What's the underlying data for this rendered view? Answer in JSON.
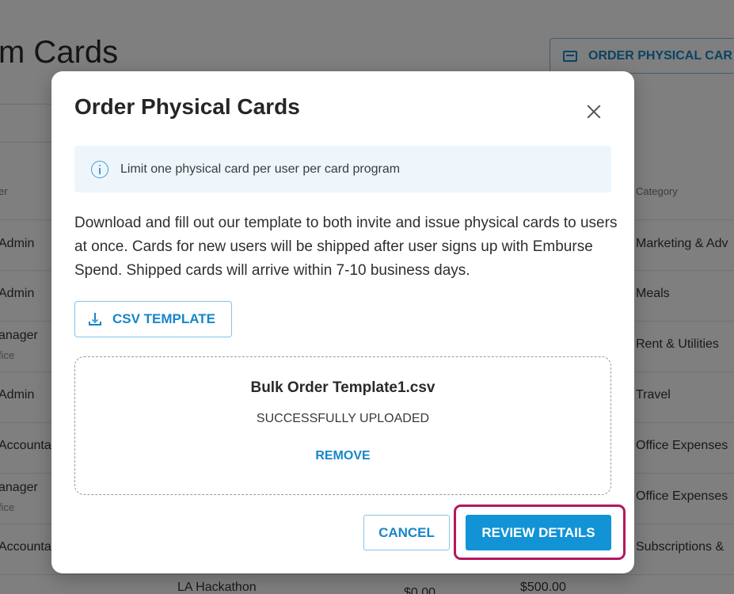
{
  "background": {
    "page_title": "m Cards",
    "order_button_label": "ORDER PHYSICAL CAR",
    "column_left_header": "er",
    "column_category_header": "Category",
    "rows": [
      {
        "left": "Admin",
        "left_sub": "",
        "category": "Marketing & Adv"
      },
      {
        "left": "Admin",
        "left_sub": "",
        "category": "Meals"
      },
      {
        "left": "anager",
        "left_sub": "fice",
        "category": "Rent & Utilities"
      },
      {
        "left": "Admin",
        "left_sub": "",
        "category": "Travel"
      },
      {
        "left": "Accounta",
        "left_sub": "",
        "category": "Office Expenses"
      },
      {
        "left": "anager",
        "left_sub": "fice",
        "category": "Office Expenses"
      },
      {
        "left": "Accounta",
        "left_sub": "",
        "category": "Subscriptions &"
      }
    ],
    "bottom_row": {
      "name": "LA Hackathon",
      "amount1": "$0.00",
      "amount2": "$500.00"
    }
  },
  "modal": {
    "title": "Order Physical Cards",
    "info_text": "Limit one physical card per user per card program",
    "description": "Download and fill out our template to both invite and issue physical cards to users at once. Cards for new users will be shipped after user signs up with Emburse Spend. Shipped cards will arrive within 7-10 business days.",
    "csv_template_label": "CSV TEMPLATE",
    "upload": {
      "file_name": "Bulk Order Template1.csv",
      "status": "SUCCESSFULLY UPLOADED",
      "remove_label": "REMOVE"
    },
    "cancel_label": "CANCEL",
    "review_label": "REVIEW DETAILS"
  },
  "colors": {
    "accent": "#1293d6",
    "highlight": "#b5175f",
    "info_bg": "#eef6fc"
  }
}
